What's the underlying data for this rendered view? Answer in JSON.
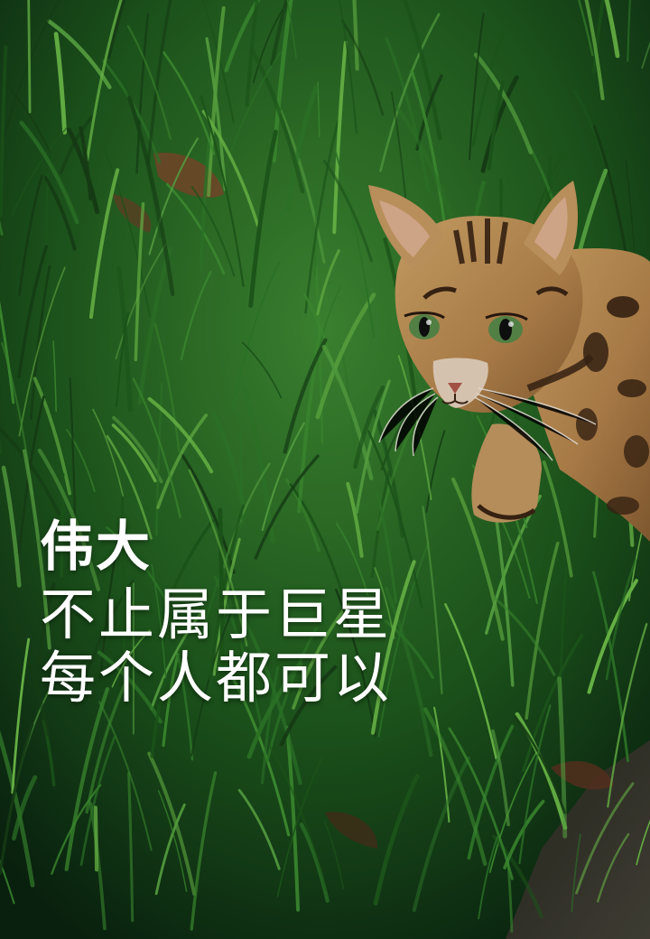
{
  "poster": {
    "headline": "伟大",
    "lines": [
      "不止属于巨星",
      "每个人都可以"
    ]
  },
  "photo": {
    "subject": "tabby-cat-in-grass",
    "colors": {
      "grass_dark": "#0b2a10",
      "grass_mid": "#2f7a2a",
      "grass_light": "#6fbf4a",
      "cat_fur": "#b98a52",
      "cat_stripe": "#3a2414",
      "cat_eye": "#5a8a4a",
      "text": "#ffffff"
    }
  }
}
